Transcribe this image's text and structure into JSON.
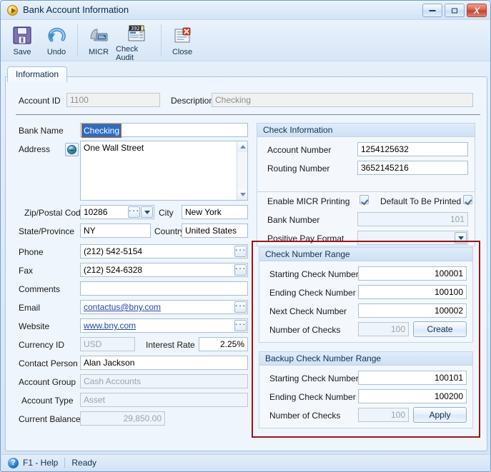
{
  "window": {
    "title": "Bank Account Information",
    "title_icon": "orange-play-circle-icon",
    "buttons": {
      "minimize": "minimize-icon",
      "maximize": "maximize-icon",
      "close": "X"
    }
  },
  "toolbar": {
    "items": [
      {
        "label": "Save",
        "icon": "floppy-disk-save-icon"
      },
      {
        "label": "Undo",
        "icon": "blue-undo-arrow-icon"
      },
      {
        "label": "MICR",
        "icon": "computer-monitor-icon"
      },
      {
        "label": "Check Audit",
        "icon": "check-audit-numbers-icon"
      },
      {
        "label": "Close",
        "icon": "document-with-red-x-icon"
      }
    ]
  },
  "tabs": [
    {
      "label": "Information",
      "active": true
    }
  ],
  "header": {
    "account_id_label": "Account ID",
    "account_id_value": "1100",
    "description_label": "Description",
    "description_value": "Checking"
  },
  "left": {
    "bank_name_label": "Bank Name",
    "bank_name_value": "Checking",
    "address_label": "Address",
    "address_value": "One Wall Street",
    "zip_label": "Zip/Postal Code",
    "zip_value": "10286",
    "city_label": "City",
    "city_value": "New York",
    "state_label": "State/Province",
    "state_value": "NY",
    "country_label": "Country",
    "country_value": "United States",
    "phone_label": "Phone",
    "phone_value": "(212) 542-5154",
    "fax_label": "Fax",
    "fax_value": "(212) 524-6328",
    "comments_label": "Comments",
    "comments_value": "",
    "email_label": "Email",
    "email_value": "contactus@bny.com",
    "website_label": "Website",
    "website_value": "www.bny.com",
    "currency_label": "Currency ID",
    "currency_value": "USD",
    "interest_label": "Interest Rate",
    "interest_value": "2.25%",
    "contact_label": "Contact Person",
    "contact_value": "Alan Jackson",
    "group_label": "Account Group",
    "group_value": "Cash Accounts",
    "type_label": "Account Type",
    "type_value": "Asset",
    "balance_label": "Current Balance",
    "balance_value": "29,850.00"
  },
  "check_information": {
    "title": "Check Information",
    "account_number_label": "Account Number",
    "account_number_value": "1254125632",
    "routing_number_label": "Routing Number",
    "routing_number_value": "3652145216",
    "enable_micr_label": "Enable MICR Printing",
    "enable_micr_checked": true,
    "default_printed_label": "Default To Be Printed",
    "default_printed_checked": true,
    "bank_number_label": "Bank Number",
    "bank_number_value": "101",
    "positive_pay_label": "Positive Pay Format",
    "positive_pay_value": ""
  },
  "check_number_range": {
    "title": "Check Number Range",
    "starting_label": "Starting Check Number",
    "starting_value": "100001",
    "ending_label": "Ending Check Number",
    "ending_value": "100100",
    "next_label": "Next Check Number",
    "next_value": "100002",
    "count_label": "Number of Checks",
    "count_value": "100",
    "action_label": "Create"
  },
  "backup_check_number_range": {
    "title": "Backup Check Number Range",
    "starting_label": "Starting Check Number",
    "starting_value": "100101",
    "ending_label": "Ending Check Number",
    "ending_value": "100200",
    "count_label": "Number of Checks",
    "count_value": "100",
    "action_label": "Apply"
  },
  "statusbar": {
    "help_icon": "question-mark-icon",
    "help_label": "F1 - Help",
    "status_label": "Ready"
  },
  "colors": {
    "highlight_border": "#9e1414",
    "titlebar": "#dfebf9",
    "panel_bg": "#eff5fc",
    "group_header": "#cfe1f4",
    "link": "#2446a8",
    "selection": "#2b6dc2"
  }
}
